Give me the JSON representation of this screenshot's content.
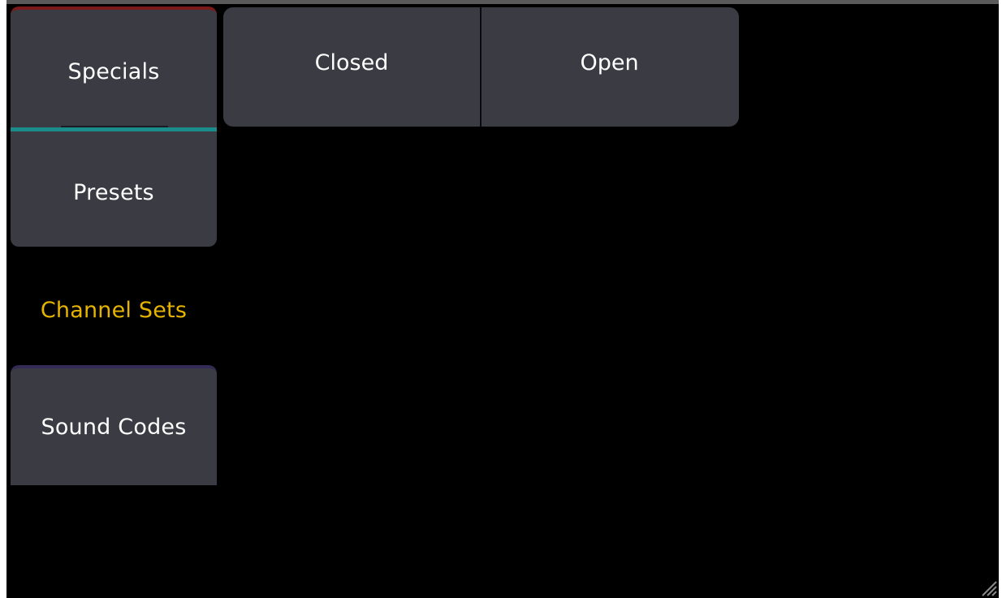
{
  "categories": {
    "specials": "Specials",
    "presets": "Presets",
    "channel_sets": "Channel Sets",
    "sound_codes": "Sound Codes"
  },
  "actions": {
    "closed": "Closed",
    "open": "Open"
  },
  "colors": {
    "background": "#000000",
    "tab_bg": "#3a3b43",
    "specials_accent": "#7a1a1a",
    "presets_accent": "#1a8c8c",
    "sound_codes_accent": "#332a55",
    "selected_text": "#e6b400"
  },
  "icons": {
    "resize": "resize-grip-icon"
  }
}
